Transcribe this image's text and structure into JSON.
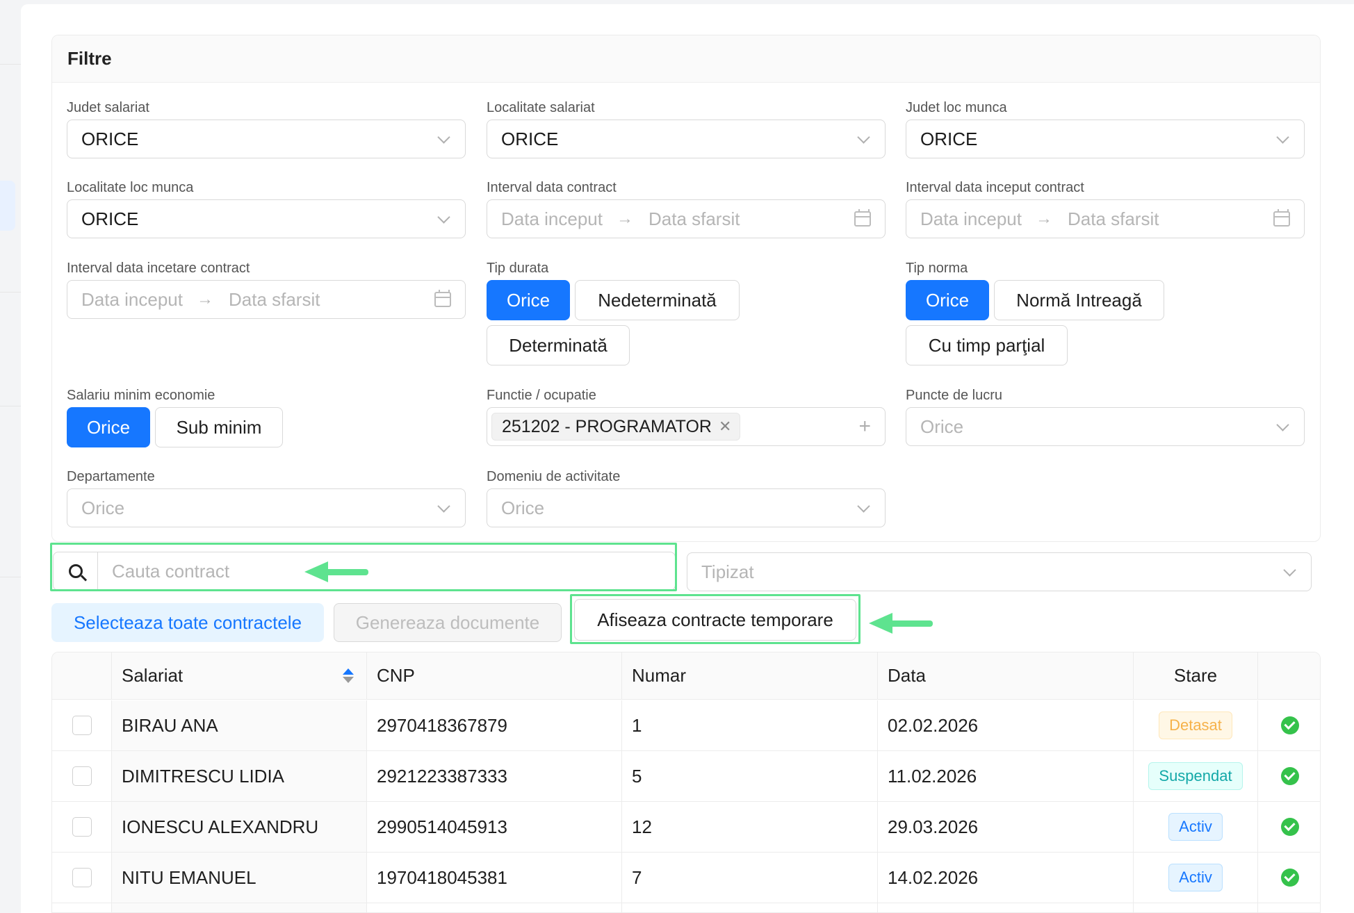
{
  "filters": {
    "title": "Filtre",
    "judet_salariat": {
      "label": "Judet salariat",
      "value": "ORICE"
    },
    "localitate_salariat": {
      "label": "Localitate salariat",
      "value": "ORICE"
    },
    "judet_loc_munca": {
      "label": "Judet loc munca",
      "value": "ORICE"
    },
    "localitate_loc_munca": {
      "label": "Localitate loc munca",
      "value": "ORICE"
    },
    "interval_data_contract": {
      "label": "Interval data contract",
      "start_placeholder": "Data inceput",
      "end_placeholder": "Data sfarsit"
    },
    "interval_data_inceput_contract": {
      "label": "Interval data inceput contract",
      "start_placeholder": "Data inceput",
      "end_placeholder": "Data sfarsit"
    },
    "interval_data_incetare_contract": {
      "label": "Interval data incetare contract",
      "start_placeholder": "Data inceput",
      "end_placeholder": "Data sfarsit"
    },
    "tip_durata": {
      "label": "Tip durata",
      "options": [
        "Orice",
        "Nedeterminată",
        "Determinată"
      ],
      "selected": "Orice"
    },
    "tip_norma": {
      "label": "Tip norma",
      "options": [
        "Orice",
        "Normă Intreagă",
        "Cu timp parţial"
      ],
      "selected": "Orice"
    },
    "salariu_minim": {
      "label": "Salariu minim economie",
      "options": [
        "Orice",
        "Sub minim"
      ],
      "selected": "Orice"
    },
    "functie": {
      "label": "Functie / ocupatie",
      "tag": "251202 - PROGRAMATOR"
    },
    "puncte_lucru": {
      "label": "Puncte de lucru",
      "placeholder": "Orice"
    },
    "departamente": {
      "label": "Departamente",
      "placeholder": "Orice"
    },
    "domeniu": {
      "label": "Domeniu de activitate",
      "placeholder": "Orice"
    }
  },
  "search": {
    "placeholder": "Cauta contract"
  },
  "tipizat": {
    "placeholder": "Tipizat"
  },
  "actions": {
    "select_all": "Selecteaza toate contractele",
    "generate": "Genereaza documente",
    "show_temp": "Afiseaza contracte temporare"
  },
  "table": {
    "headers": {
      "salariat": "Salariat",
      "cnp": "CNP",
      "numar": "Numar",
      "data": "Data",
      "stare": "Stare"
    },
    "rows": [
      {
        "salariat": "BIRAU ANA",
        "cnp": "2970418367879",
        "numar": "1",
        "data": "02.02.2026",
        "stare": "Detasat"
      },
      {
        "salariat": "DIMITRESCU LIDIA",
        "cnp": "2921223387333",
        "numar": "5",
        "data": "11.02.2026",
        "stare": "Suspendat"
      },
      {
        "salariat": "IONESCU ALEXANDRU",
        "cnp": "2990514045913",
        "numar": "12",
        "data": "29.03.2026",
        "stare": "Activ"
      },
      {
        "salariat": "NITU EMANUEL",
        "cnp": "1970418045381",
        "numar": "7",
        "data": "14.02.2026",
        "stare": "Activ"
      }
    ]
  },
  "colors": {
    "primary": "#1677ff",
    "highlight": "#5ee38f",
    "detasat_bg": "#fff7e6",
    "detasat_fg": "#f6b24a",
    "suspendat_bg": "#e6fffb",
    "suspendat_fg": "#13a8a8",
    "activ_bg": "#e6f4ff",
    "activ_fg": "#1677ff"
  }
}
